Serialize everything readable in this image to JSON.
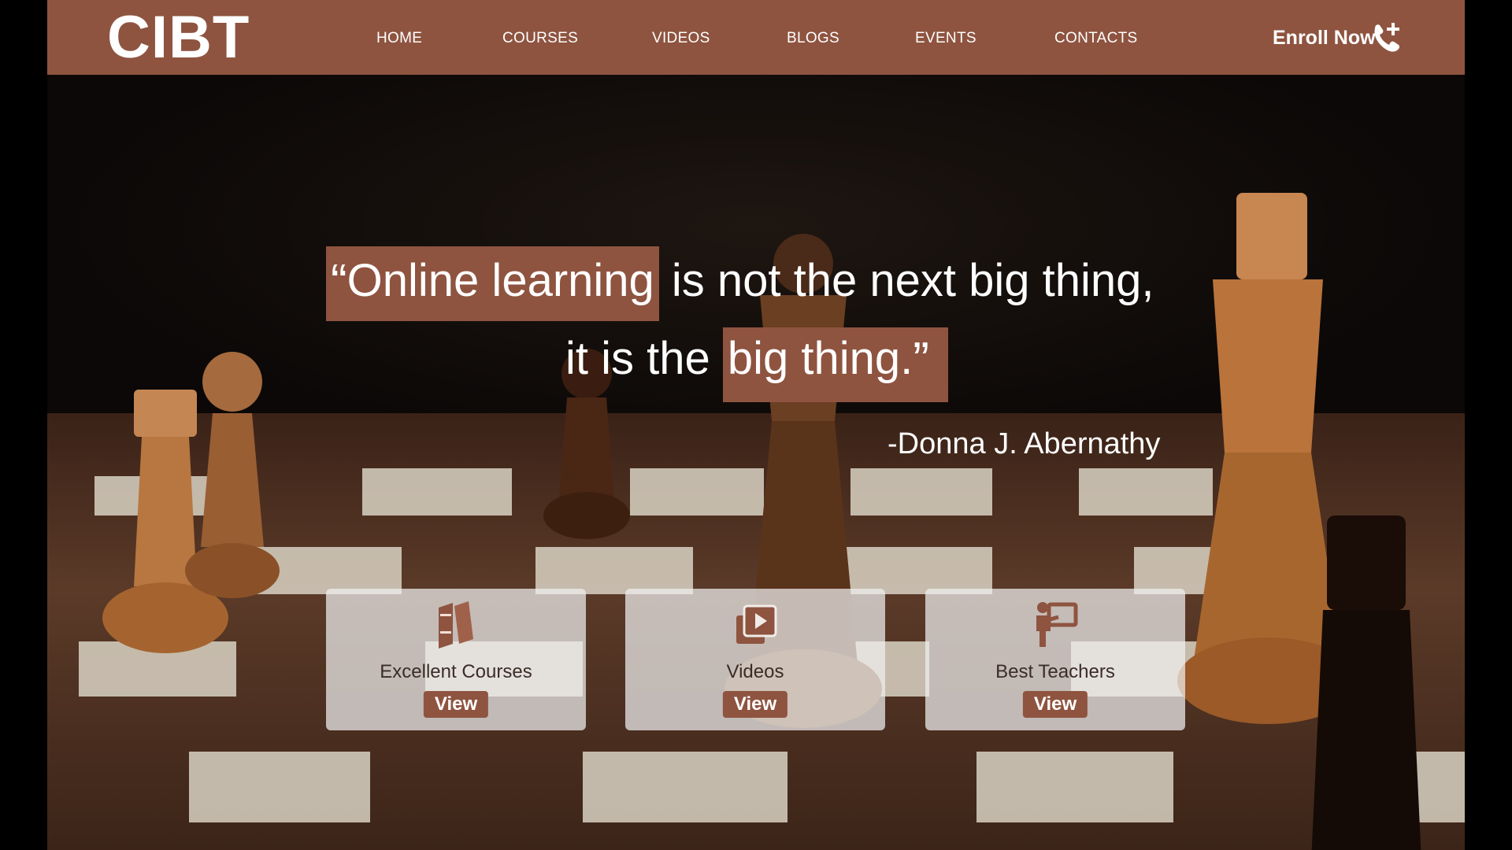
{
  "brand": {
    "logo": "CIBT",
    "accent": "#8e5440"
  },
  "nav": {
    "items": [
      "HOME",
      "COURSES",
      "VIDEOS",
      "BLOGS",
      "EVENTS",
      "CONTACTS"
    ]
  },
  "cta": {
    "enroll_label": "Enroll Now",
    "icon": "phone-plus-icon"
  },
  "hero": {
    "quote": {
      "line1_highlight": "Online learning",
      "line1_rest": " is not the next big thing,",
      "line2_lead": "it is the ",
      "line2_highlight": "big thing.",
      "open_mark": "“",
      "close_mark": "”"
    },
    "author": "-Donna J.  Abernathy"
  },
  "cards": [
    {
      "title": "Excellent Courses",
      "button": "View",
      "icon": "books-icon"
    },
    {
      "title": "Videos",
      "button": "View",
      "icon": "video-play-icon"
    },
    {
      "title": "Best Teachers",
      "button": "View",
      "icon": "teacher-icon"
    }
  ]
}
